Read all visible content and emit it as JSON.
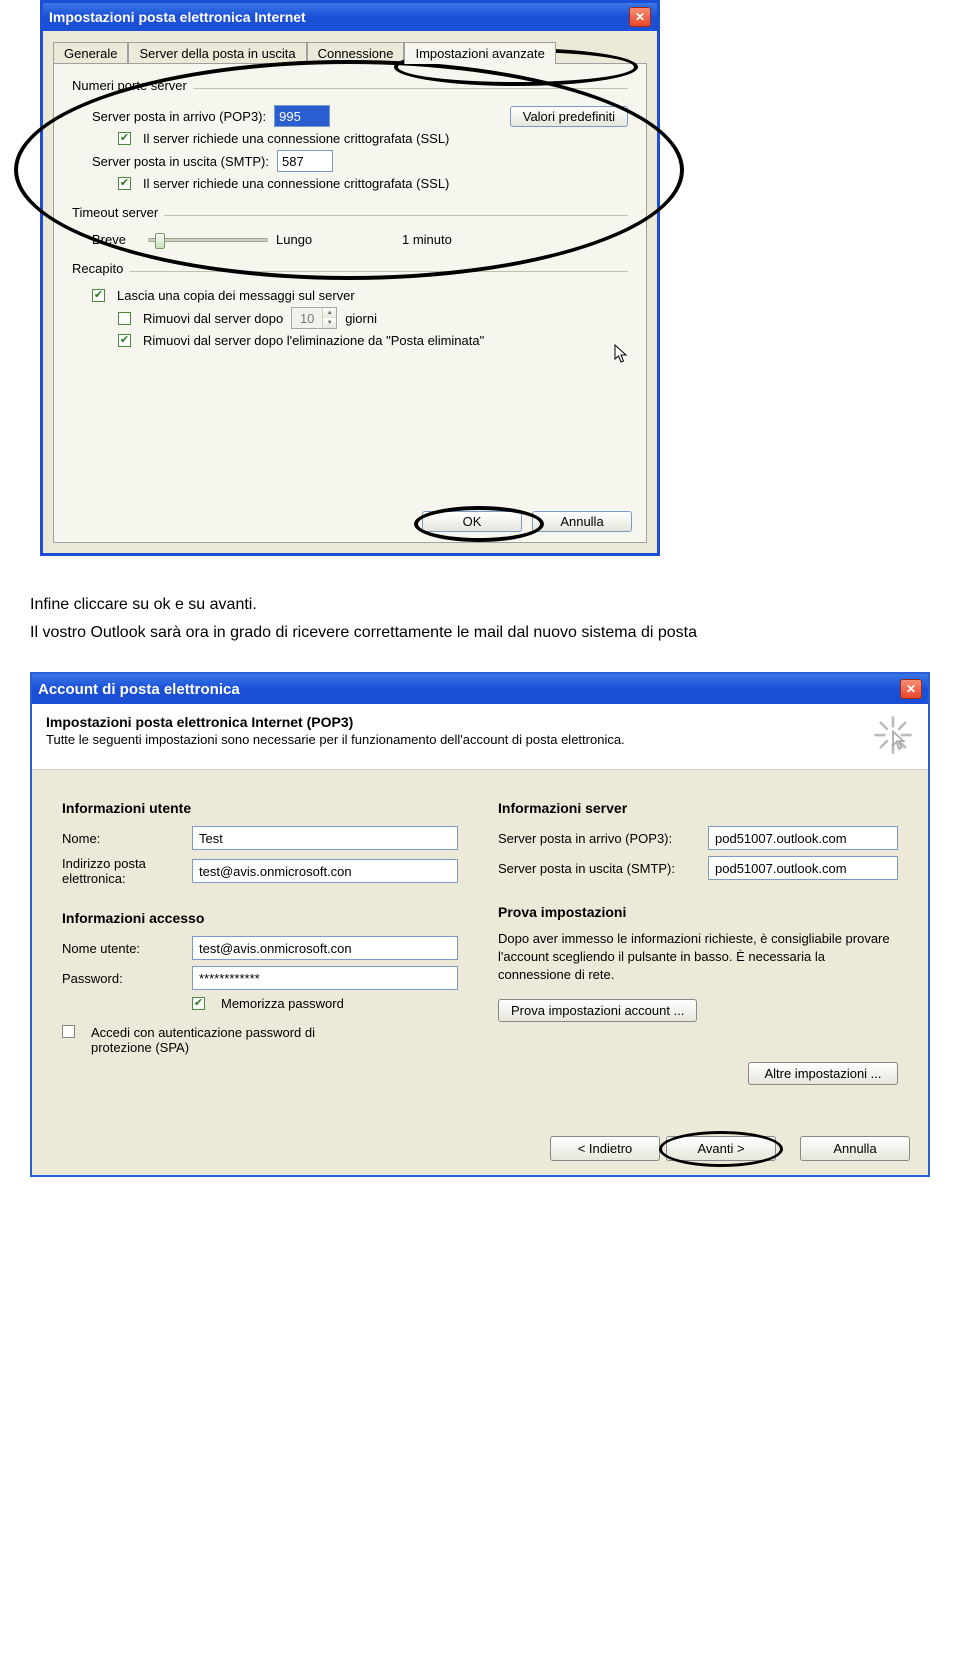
{
  "dialog1": {
    "title": "Impostazioni posta elettronica Internet",
    "tabs": {
      "general": "Generale",
      "outgoing": "Server della posta in uscita",
      "connection": "Connessione",
      "advanced": "Impostazioni avanzate"
    },
    "groups": {
      "ports_label": "Numeri porte server",
      "incoming_label": "Server posta in arrivo (POP3):",
      "incoming_value": "995",
      "defaults_btn": "Valori predefiniti",
      "ssl_incoming": "Il server richiede una connessione crittografata (SSL)",
      "outgoing_label": "Server posta in uscita (SMTP):",
      "outgoing_value": "587",
      "ssl_outgoing": "Il server richiede una connessione crittografata (SSL)",
      "timeout_label": "Timeout server",
      "timeout_short": "Breve",
      "timeout_long": "Lungo",
      "timeout_val": "1 minuto",
      "delivery_label": "Recapito",
      "leave_copy": "Lascia una copia dei messaggi sul server",
      "remove_after_label": "Rimuovi dal server dopo",
      "remove_after_value": "10",
      "remove_after_days": "giorni",
      "remove_on_delete": "Rimuovi dal server dopo l'eliminazione da \"Posta eliminata\""
    },
    "buttons": {
      "ok": "OK",
      "cancel": "Annulla"
    }
  },
  "body_text": {
    "line1": "Infine cliccare su ok e su avanti.",
    "line2": "Il vostro Outlook sarà ora in grado di ricevere correttamente le mail dal nuovo sistema di posta"
  },
  "dialog2": {
    "title": "Account di posta elettronica",
    "header_title": "Impostazioni posta elettronica Internet (POP3)",
    "header_sub": "Tutte le seguenti impostazioni sono necessarie per il funzionamento dell'account di posta elettronica.",
    "sections": {
      "user": "Informazioni utente",
      "server": "Informazioni server",
      "access": "Informazioni accesso",
      "test": "Prova impostazioni"
    },
    "fields": {
      "name_lbl": "Nome:",
      "name_val": "Test",
      "email_lbl": "Indirizzo posta elettronica:",
      "email_val": "test@avis.onmicrosoft.con",
      "incoming_lbl": "Server posta in arrivo (POP3):",
      "incoming_val": "pod51007.outlook.com",
      "outgoing_lbl": "Server posta in uscita (SMTP):",
      "outgoing_val": "pod51007.outlook.com",
      "user_lbl": "Nome utente:",
      "user_val": "test@avis.onmicrosoft.con",
      "pass_lbl": "Password:",
      "pass_val": "************",
      "remember": "Memorizza password",
      "spa": "Accedi con autenticazione password di protezione (SPA)",
      "test_text": "Dopo aver immesso le informazioni richieste, è consigliabile provare l'account scegliendo il pulsante in basso. È necessaria la connessione di rete."
    },
    "buttons": {
      "test": "Prova impostazioni account ...",
      "more": "Altre impostazioni ...",
      "back": "< Indietro",
      "next": "Avanti >",
      "cancel": "Annulla"
    }
  }
}
